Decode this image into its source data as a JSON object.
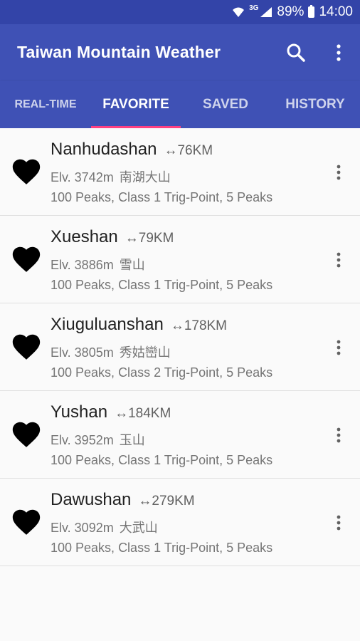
{
  "status_bar": {
    "network": "3G",
    "battery": "89%",
    "time": "14:00"
  },
  "app_bar": {
    "title": "Taiwan Mountain Weather",
    "icons": [
      "search-icon",
      "more-vert-icon"
    ]
  },
  "tabs": [
    {
      "label": "REAL-TIME",
      "active": false
    },
    {
      "label": "FAVORITE",
      "active": true
    },
    {
      "label": "SAVED",
      "active": false
    },
    {
      "label": "HISTORY",
      "active": false
    }
  ],
  "colors": {
    "primary": "#3f51b5",
    "primary_dark": "#3344a8",
    "accent": "#ff4081"
  },
  "peaks": [
    {
      "name": "Nanhudashan",
      "distance": "↔76KM",
      "elevation": "Elv. 3742m",
      "zh_name": "南湖大山",
      "categories": "100 Peaks, Class 1 Trig-Point, 5 Peaks"
    },
    {
      "name": "Xueshan",
      "distance": "↔79KM",
      "elevation": "Elv. 3886m",
      "zh_name": "雪山",
      "categories": "100 Peaks, Class 1 Trig-Point, 5 Peaks"
    },
    {
      "name": "Xiuguluanshan",
      "distance": "↔178KM",
      "elevation": "Elv. 3805m",
      "zh_name": "秀姑巒山",
      "categories": "100 Peaks, Class 2 Trig-Point, 5 Peaks"
    },
    {
      "name": "Yushan",
      "distance": "↔184KM",
      "elevation": "Elv. 3952m",
      "zh_name": "玉山",
      "categories": "100 Peaks, Class 1 Trig-Point, 5 Peaks"
    },
    {
      "name": "Dawushan",
      "distance": "↔279KM",
      "elevation": "Elv. 3092m",
      "zh_name": "大武山",
      "categories": "100 Peaks, Class 1 Trig-Point, 5 Peaks"
    }
  ]
}
